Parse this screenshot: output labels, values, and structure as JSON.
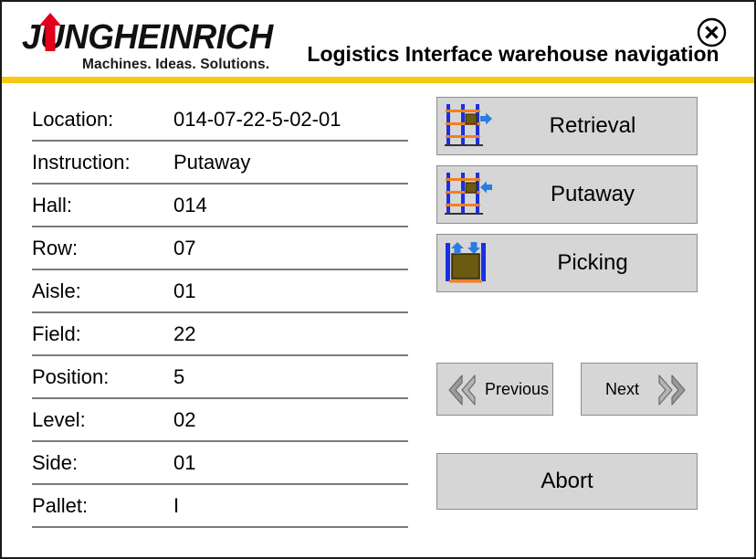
{
  "header": {
    "logo_wordmark": "JUNGHEINRICH",
    "logo_tagline": "Machines. Ideas. Solutions.",
    "title": "Logistics Interface warehouse navigation",
    "close_icon": "close-circle-icon",
    "accent_bar_color": "#f5cb11",
    "logo_arrow_color": "#e2001a"
  },
  "info": {
    "rows": [
      {
        "label": "Location:",
        "value": "014-07-22-5-02-01"
      },
      {
        "label": "Instruction:",
        "value": "Putaway"
      },
      {
        "label": "Hall:",
        "value": "014"
      },
      {
        "label": "Row:",
        "value": "07"
      },
      {
        "label": "Aisle:",
        "value": "01"
      },
      {
        "label": "Field:",
        "value": "22"
      },
      {
        "label": "Position:",
        "value": "5"
      },
      {
        "label": "Level:",
        "value": "02"
      },
      {
        "label": "Side:",
        "value": "01"
      },
      {
        "label": "Pallet:",
        "value": "I"
      }
    ]
  },
  "actions": {
    "retrieval": {
      "label": "Retrieval",
      "icon": "rack-arrow-right-icon"
    },
    "putaway": {
      "label": "Putaway",
      "icon": "rack-arrow-left-icon"
    },
    "picking": {
      "label": "Picking",
      "icon": "pallet-arrows-updown-icon"
    }
  },
  "navigation": {
    "previous": {
      "label": "Previous",
      "icon": "double-chevron-left-icon"
    },
    "next": {
      "label": "Next",
      "icon": "double-chevron-right-icon"
    }
  },
  "abort": {
    "label": "Abort"
  },
  "colors": {
    "button_face": "#d6d6d6",
    "button_border": "#8c8c8c",
    "rack_post": "#1a30e0",
    "rack_shelf": "#f08020",
    "box": "#6b5a10",
    "arrow": "#2a7de1",
    "separator": "#7a7a7a"
  }
}
